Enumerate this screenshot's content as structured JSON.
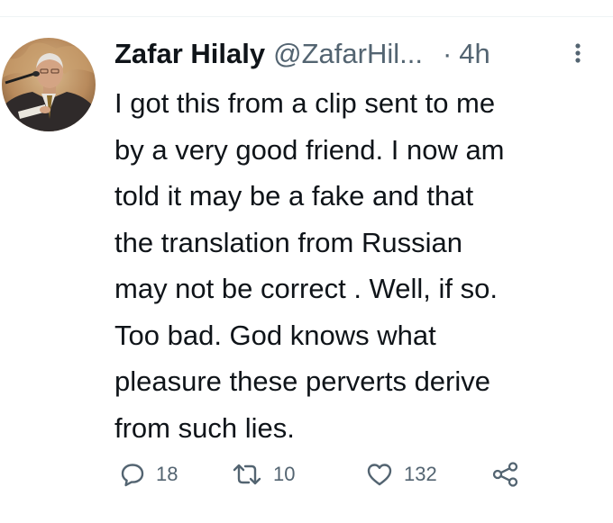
{
  "author": {
    "display_name": "Zafar Hilaly",
    "handle": "@ZafarHil...",
    "separator": "·",
    "time": "4h",
    "avatar_icon": "profile-photo"
  },
  "tweet": {
    "lines": [
      "I got this from a clip sent to me",
      "by a very good friend. I now am",
      "told it may be a fake and that",
      "the translation from Russian",
      "may not be correct . Well, if so.",
      "Too bad. God knows what",
      "pleasure these perverts derive",
      "from such lies."
    ]
  },
  "actions": {
    "reply": {
      "icon": "reply-icon",
      "count": "18"
    },
    "retweet": {
      "icon": "retweet-icon",
      "count": "10"
    },
    "like": {
      "icon": "heart-icon",
      "count": "132"
    },
    "share": {
      "icon": "share-icon"
    }
  },
  "colors": {
    "text": "#0f1419",
    "secondary": "#536471",
    "divider": "#eff3f4"
  }
}
